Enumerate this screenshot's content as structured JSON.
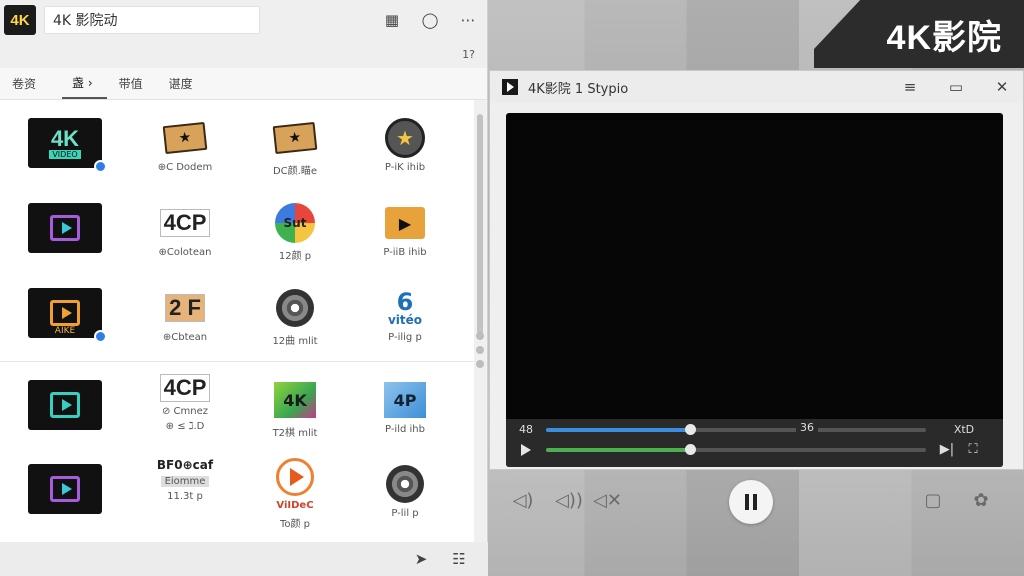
{
  "brand": {
    "banner_text": "4K影院"
  },
  "launcher": {
    "logo_text": "4K",
    "search_text": "4K 影院动",
    "sub_label": "1?",
    "tabs": [
      {
        "label": "卷资"
      },
      {
        "label": "盏 ›"
      },
      {
        "label": "带值"
      },
      {
        "label": "谌度"
      }
    ],
    "apps": [
      {
        "title": "4K",
        "subtitle": "VIDEO",
        "label": ""
      },
      {
        "label": "⊕C Dodem"
      },
      {
        "label": "DC颜.瞄e"
      },
      {
        "label": "P-iK ihib"
      },
      {
        "label": ""
      },
      {
        "title": "4CP",
        "label": "⊕Colotean"
      },
      {
        "title": "Sut",
        "label": "12颜 p"
      },
      {
        "label": "P-iiB ihib"
      },
      {
        "tile_text": "AIKE",
        "label": ""
      },
      {
        "title": "2 F",
        "label": "⊕Cbtean"
      },
      {
        "label": "12曲 mlit"
      },
      {
        "title": "vitéo",
        "label": "P-ilig p"
      },
      {
        "label": ""
      },
      {
        "title": "4CP",
        "subtitle": "⊘ Cmnez",
        "label": "⊕ ≤ ℷ.D"
      },
      {
        "title": "4K",
        "label": "T2棋 mlit"
      },
      {
        "title": "4P",
        "label": "P-ild ihb"
      },
      {
        "label": ""
      },
      {
        "title": "BF0⊕caf",
        "subtitle": "Eiomme",
        "label": "11.3t p"
      },
      {
        "title": "ViIDeC",
        "label": "To颜 p"
      },
      {
        "label": "P-lil p"
      }
    ]
  },
  "player": {
    "title": "4K影院 1 Stypio",
    "time_elapsed": "48",
    "time_middle": "36",
    "time_right": "XtD",
    "progress_fraction": 0.38,
    "volume_fraction": 0.38
  },
  "colors": {
    "progress": "#3a8ee0",
    "volume": "#4caf50",
    "accent": "#37d0c0"
  }
}
